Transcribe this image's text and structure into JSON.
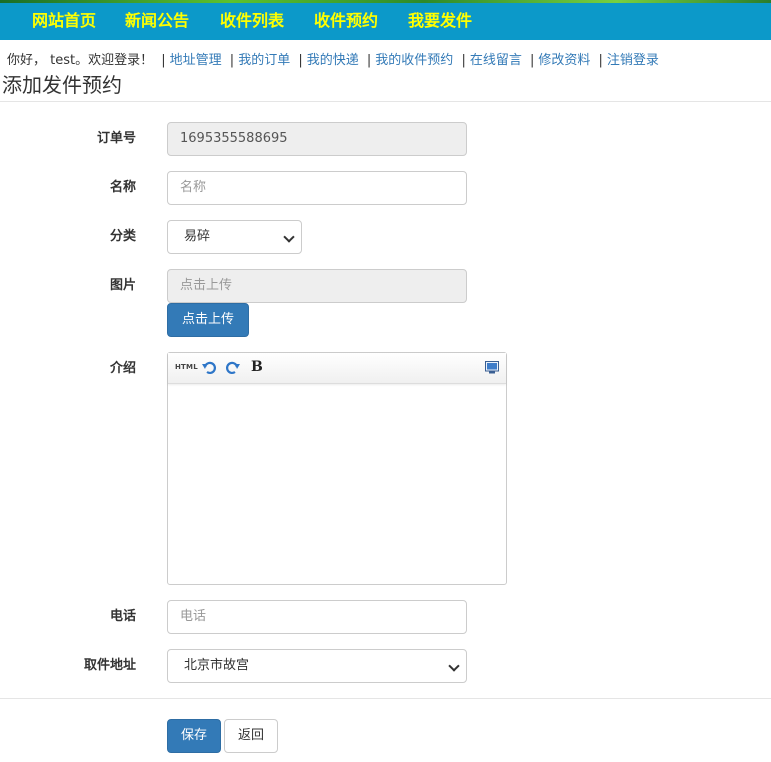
{
  "nav": {
    "items": [
      "网站首页",
      "新闻公告",
      "收件列表",
      "收件预约",
      "我要发件"
    ]
  },
  "userbar": {
    "greeting": "你好， test。欢迎登录！",
    "links": [
      "地址管理",
      "我的订单",
      "我的快递",
      "我的收件预约",
      "在线留言",
      "修改资料",
      "注销登录"
    ]
  },
  "page": {
    "title": "添加发件预约"
  },
  "form": {
    "order_no": {
      "label": "订单号",
      "value": "1695355588695"
    },
    "name": {
      "label": "名称",
      "placeholder": "名称"
    },
    "category": {
      "label": "分类",
      "value": "易碎"
    },
    "image": {
      "label": "图片",
      "placeholder": "点击上传",
      "button": "点击上传"
    },
    "intro": {
      "label": "介绍",
      "toolbar_html": "HTML",
      "toolbar_bold": "B"
    },
    "phone": {
      "label": "电话",
      "placeholder": "电话"
    },
    "address": {
      "label": "取件地址",
      "value": "北京市故宫"
    },
    "save_label": "保存",
    "back_label": "返回"
  }
}
